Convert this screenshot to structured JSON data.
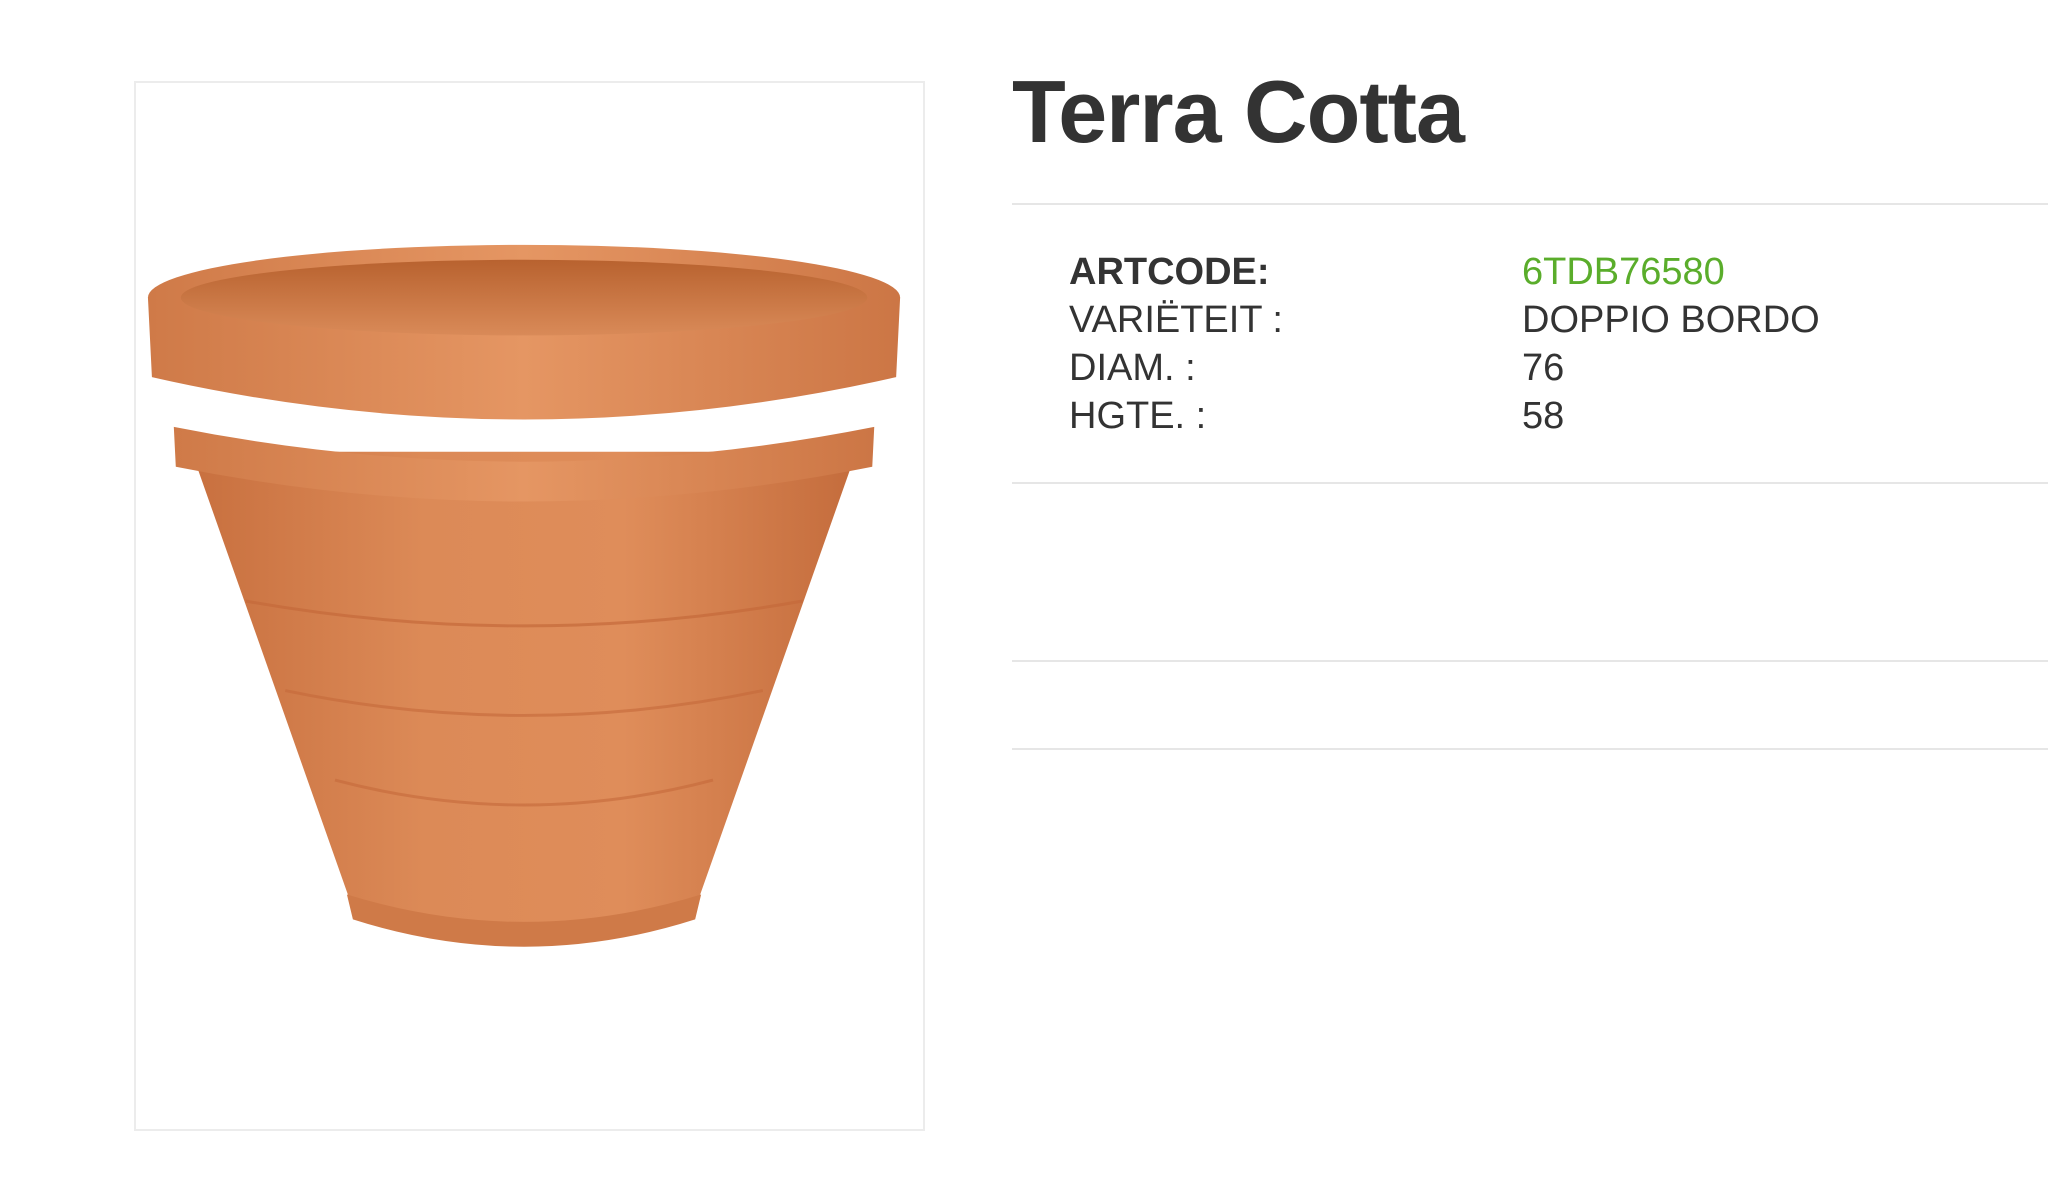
{
  "product": {
    "title": "Terra Cotta",
    "image_alt": "terracotta-pot-photo"
  },
  "specs": [
    {
      "label": "ARTCODE:",
      "value": "6TDB76580"
    },
    {
      "label": "VARIËTEIT :",
      "value": "DOPPIO BORDO"
    },
    {
      "label": "DIAM. :",
      "value": "76"
    },
    {
      "label": "HGTE. :",
      "value": "58"
    }
  ],
  "colors": {
    "title": "#333333",
    "artcode_value": "#5aad2b",
    "divider": "#e6e6e6",
    "pot": "#d9834f"
  }
}
